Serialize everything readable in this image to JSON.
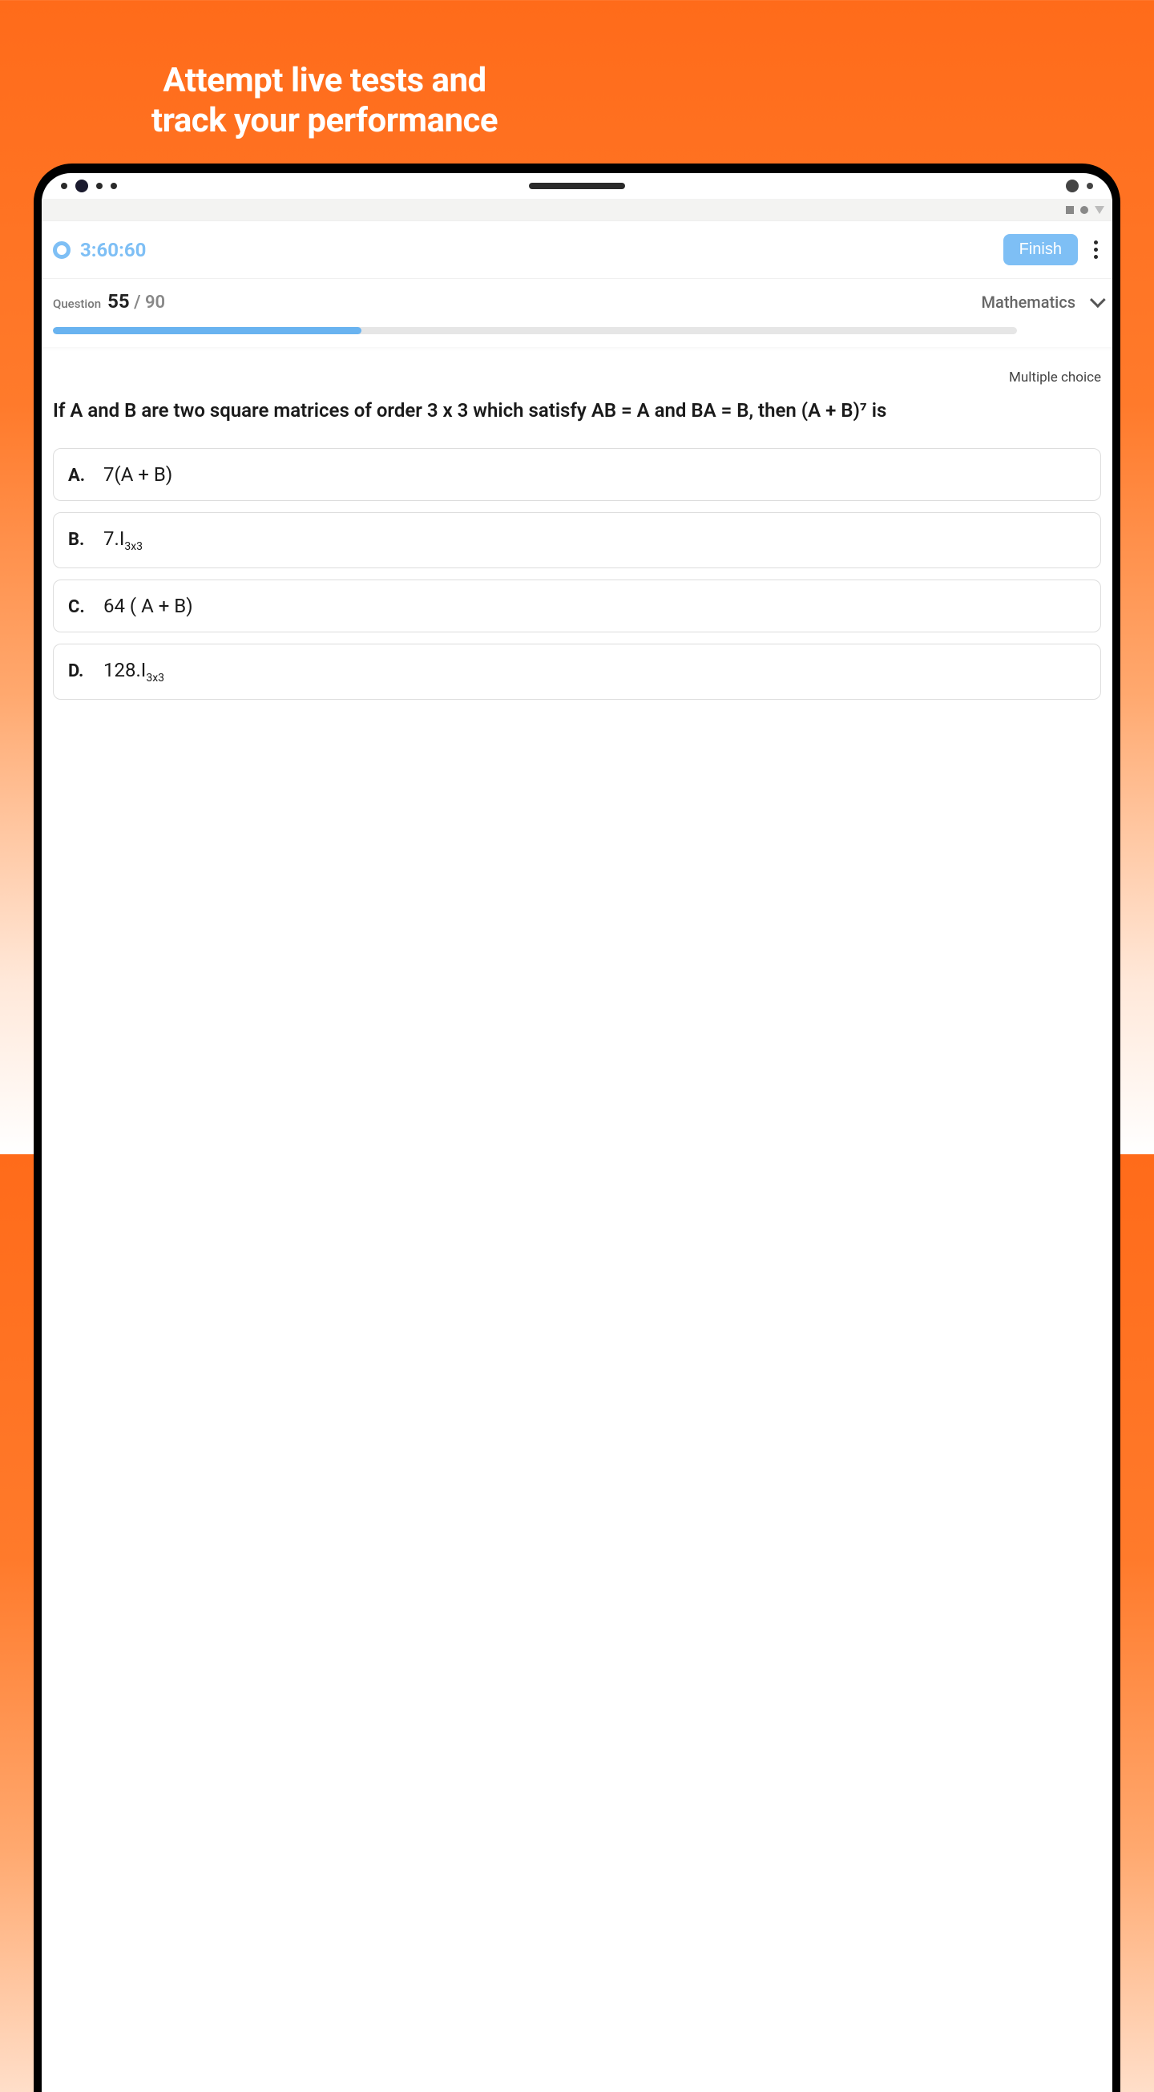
{
  "marketing": {
    "headline_line1": "Attempt live tests and",
    "headline_line2": "track your performance"
  },
  "header": {
    "timer": "3:60:60",
    "finish_label": "Finish"
  },
  "progress": {
    "question_label": "Question",
    "current": "55",
    "separator": " / ",
    "total": "90",
    "subject": "Mathematics",
    "percent": 32
  },
  "question": {
    "type_label": "Multiple choice",
    "text": "If A and B are two square matrices of order 3 x 3 which satisfy AB = A and BA = B, then (A + B)⁷ is",
    "options": [
      {
        "letter": "A.",
        "text": "7(A + B)"
      },
      {
        "letter": "B.",
        "text": "7.I",
        "sub": "3x3"
      },
      {
        "letter": "C.",
        "text": "64 ( A + B)"
      },
      {
        "letter": "D.",
        "text": "128.I",
        "sub": "3x3"
      }
    ]
  }
}
